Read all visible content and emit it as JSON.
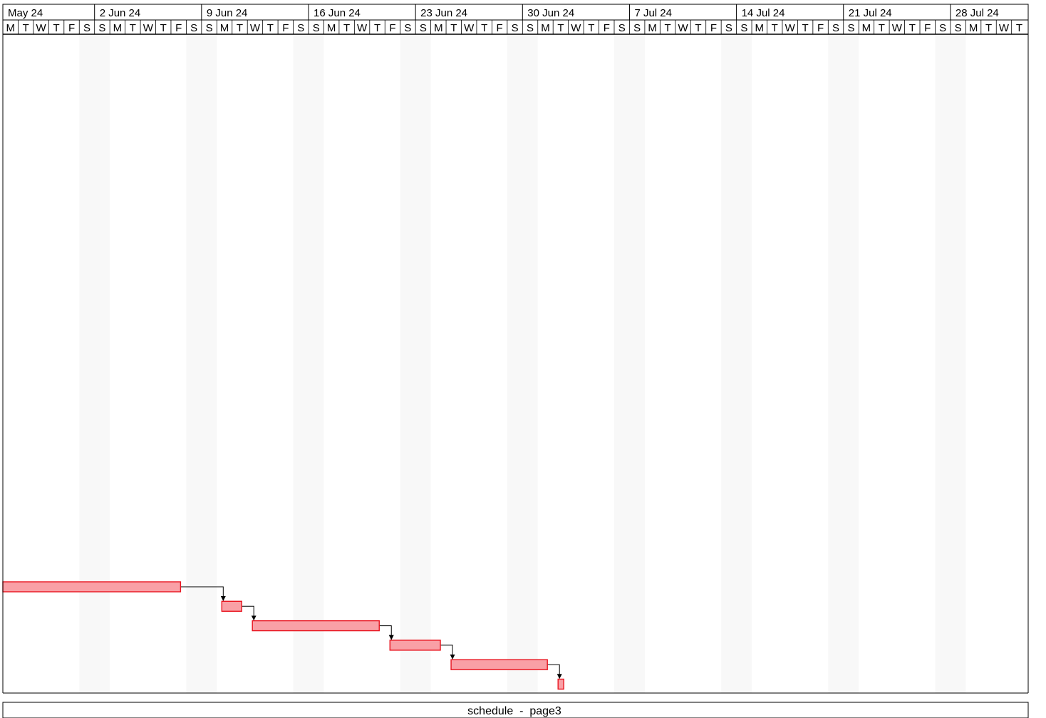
{
  "timeline": {
    "weeks": [
      "May 24",
      "2 Jun 24",
      "9 Jun 24",
      "16 Jun 24",
      "23 Jun 24",
      "30 Jun 24",
      "7 Jul 24",
      "14 Jul 24",
      "21 Jul 24",
      "28 Jul 24"
    ],
    "day_letters": [
      "M",
      "T",
      "W",
      "T",
      "F",
      "S",
      "S"
    ]
  },
  "colors": {
    "bar_fill": "#f9a0a6",
    "bar_stroke": "#e8141f",
    "weekend_shade": "#f8f8f8",
    "line": "#000000"
  },
  "tasks": [
    {
      "start": "2024-05-27",
      "end": "2024-06-07"
    },
    {
      "start": "2024-06-10",
      "end": "2024-06-11"
    },
    {
      "start": "2024-06-12",
      "end": "2024-06-20"
    },
    {
      "start": "2024-06-21",
      "end": "2024-06-24"
    },
    {
      "start": "2024-06-25",
      "end": "2024-07-01"
    },
    {
      "start": "2024-07-02",
      "end": "2024-07-02"
    }
  ],
  "footer": {
    "title": "schedule  -  page3"
  }
}
